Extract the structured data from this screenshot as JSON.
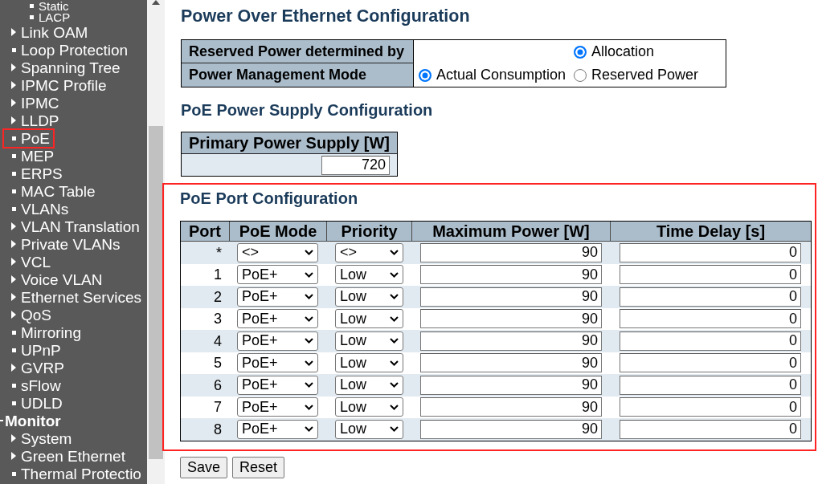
{
  "sidebar": {
    "tree": [
      {
        "children": [
          {
            "children": [
              {
                "label": "Static",
                "kind": "page",
                "highlighted": false
              },
              {
                "label": "LACP",
                "kind": "page",
                "highlighted": false
              }
            ]
          },
          {
            "label": "Link OAM",
            "kind": "folder",
            "highlighted": false
          },
          {
            "label": "Loop Protection",
            "kind": "page",
            "highlighted": false
          },
          {
            "label": "Spanning Tree",
            "kind": "folder",
            "highlighted": false
          },
          {
            "label": "IPMC Profile",
            "kind": "folder",
            "highlighted": false
          },
          {
            "label": "IPMC",
            "kind": "folder",
            "highlighted": false
          },
          {
            "label": "LLDP",
            "kind": "folder",
            "highlighted": false
          },
          {
            "label": "PoE",
            "kind": "page",
            "highlighted": true
          },
          {
            "label": "MEP",
            "kind": "page",
            "highlighted": false
          },
          {
            "label": "ERPS",
            "kind": "page",
            "highlighted": false
          },
          {
            "label": "MAC Table",
            "kind": "page",
            "highlighted": false
          },
          {
            "label": "VLANs",
            "kind": "page",
            "highlighted": false
          },
          {
            "label": "VLAN Translation",
            "kind": "folder",
            "highlighted": false
          },
          {
            "label": "Private VLANs",
            "kind": "folder",
            "highlighted": false
          },
          {
            "label": "VCL",
            "kind": "folder",
            "highlighted": false
          },
          {
            "label": "Voice VLAN",
            "kind": "folder",
            "highlighted": false
          },
          {
            "label": "Ethernet Services",
            "kind": "folder",
            "highlighted": false
          },
          {
            "label": "QoS",
            "kind": "folder",
            "highlighted": false
          },
          {
            "label": "Mirroring",
            "kind": "page",
            "highlighted": false
          },
          {
            "label": "UPnP",
            "kind": "page",
            "highlighted": false
          },
          {
            "label": "GVRP",
            "kind": "folder",
            "highlighted": false
          },
          {
            "label": "sFlow",
            "kind": "page",
            "highlighted": false
          },
          {
            "label": "UDLD",
            "kind": "page",
            "highlighted": false
          }
        ]
      },
      {
        "label": "Monitor",
        "kind": "section",
        "children": [
          {
            "label": "System",
            "kind": "folder",
            "highlighted": false
          },
          {
            "label": "Green Ethernet",
            "kind": "folder",
            "highlighted": false
          },
          {
            "label": "Thermal Protectio",
            "kind": "page",
            "highlighted": false
          }
        ]
      }
    ]
  },
  "page_title": "Power Over Ethernet Configuration",
  "power_config": {
    "rows": [
      {
        "label": "Reserved Power determined by",
        "options": [
          {
            "label": "Allocation",
            "selected": true
          }
        ]
      },
      {
        "label": "Power Management Mode",
        "options": [
          {
            "label": "Actual Consumption",
            "selected": true
          },
          {
            "label": "Reserved Power",
            "selected": false
          }
        ]
      }
    ]
  },
  "supply": {
    "title": "PoE Power Supply Configuration",
    "column": "Primary Power Supply [W]",
    "value": "720"
  },
  "port_config": {
    "title": "PoE Port Configuration",
    "highlighted": true,
    "columns": [
      "Port",
      "PoE Mode",
      "Priority",
      "Maximum Power [W]",
      "Time Delay [s]"
    ],
    "rows": [
      {
        "port": "*",
        "poe_mode": "<>",
        "priority": "<>",
        "max_power": "90",
        "time_delay": "0"
      },
      {
        "port": "1",
        "poe_mode": "PoE+",
        "priority": "Low",
        "max_power": "90",
        "time_delay": "0"
      },
      {
        "port": "2",
        "poe_mode": "PoE+",
        "priority": "Low",
        "max_power": "90",
        "time_delay": "0"
      },
      {
        "port": "3",
        "poe_mode": "PoE+",
        "priority": "Low",
        "max_power": "90",
        "time_delay": "0"
      },
      {
        "port": "4",
        "poe_mode": "PoE+",
        "priority": "Low",
        "max_power": "90",
        "time_delay": "0"
      },
      {
        "port": "5",
        "poe_mode": "PoE+",
        "priority": "Low",
        "max_power": "90",
        "time_delay": "0"
      },
      {
        "port": "6",
        "poe_mode": "PoE+",
        "priority": "Low",
        "max_power": "90",
        "time_delay": "0"
      },
      {
        "port": "7",
        "poe_mode": "PoE+",
        "priority": "Low",
        "max_power": "90",
        "time_delay": "0"
      },
      {
        "port": "8",
        "poe_mode": "PoE+",
        "priority": "Low",
        "max_power": "90",
        "time_delay": "0"
      }
    ]
  },
  "buttons": [
    "Save",
    "Reset"
  ]
}
